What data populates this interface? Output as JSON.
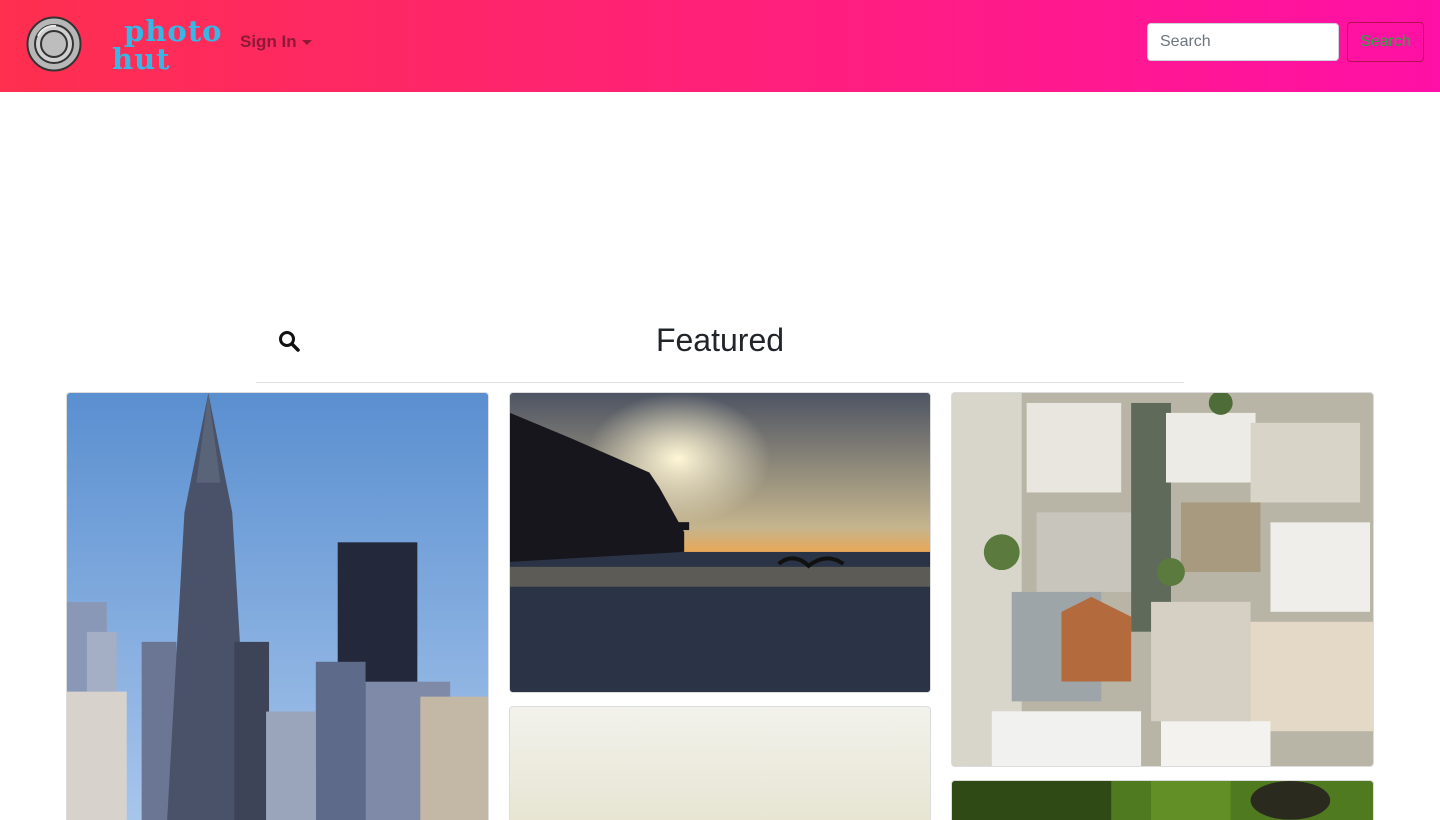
{
  "header": {
    "brand_line1": "photo",
    "brand_line2": "hut",
    "signin_label": "Sign In",
    "search_placeholder": "Search",
    "search_button_label": "Search"
  },
  "featured": {
    "title": "Featured"
  },
  "colors": {
    "nav_gradient_start": "#fe2f4f",
    "nav_gradient_end": "#ff10a6",
    "brand_text": "#36b8e6",
    "search_button_text": "#28a745"
  },
  "photos": [
    {
      "subject": "city skyline with pyramid skyscraper"
    },
    {
      "subject": "sunset over ocean with pier and seagull"
    },
    {
      "subject": "aerial view of city rooftops"
    },
    {
      "subject": "hazy bright sky"
    },
    {
      "subject": "green leaf close-up"
    }
  ]
}
